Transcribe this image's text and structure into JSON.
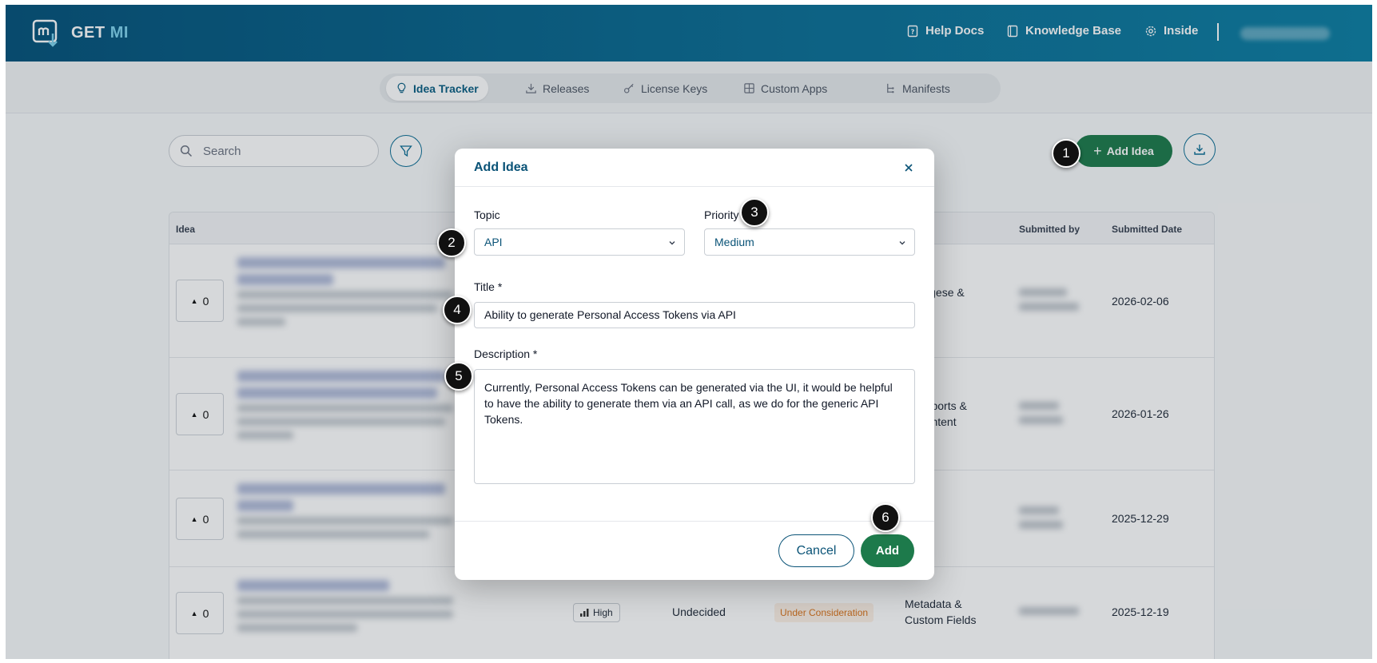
{
  "header": {
    "brand_prefix": "GET",
    "brand_suffix": "MI",
    "nav": [
      {
        "label": "Help Docs",
        "icon": "help-doc-icon"
      },
      {
        "label": "Knowledge Base",
        "icon": "book-icon"
      },
      {
        "label": "Inside",
        "icon": "settings-icon"
      }
    ]
  },
  "tabs": [
    {
      "label": "Idea Tracker",
      "icon": "lightbulb-icon",
      "active": true
    },
    {
      "label": "Releases",
      "icon": "download-icon",
      "active": false
    },
    {
      "label": "License Keys",
      "icon": "key-icon",
      "active": false
    },
    {
      "label": "Custom Apps",
      "icon": "apps-icon",
      "active": false
    },
    {
      "label": "Manifests",
      "icon": "tree-icon",
      "active": false
    }
  ],
  "toolbar": {
    "search_placeholder": "Search",
    "add_idea_label": "Add Idea",
    "add_idea_icon": "+"
  },
  "table": {
    "columns": {
      "idea": "Idea",
      "submitted_by": "Submitted by",
      "submitted_date": "Submitted Date"
    },
    "rows": [
      {
        "votes": "0",
        "category_fragment": "Privilegese &\nissions",
        "date": "2026-02-06"
      },
      {
        "votes": "0",
        "category_fragment": "nal Reports &\nnal Content",
        "date": "2026-01-26"
      },
      {
        "votes": "0",
        "category_fragment": "",
        "date": "2025-12-29"
      },
      {
        "votes": "0",
        "priority": "High",
        "decision": "Undecided",
        "status": "Under Consideration",
        "category": "Metadata &\nCustom Fields",
        "date": "2025-12-19"
      }
    ]
  },
  "modal": {
    "title": "Add Idea",
    "topic_label": "Topic",
    "topic_value": "API",
    "priority_label": "Priority",
    "priority_value": "Medium",
    "title_label": "Title *",
    "title_value": "Ability to generate Personal Access Tokens via API",
    "description_label": "Description *",
    "description_value": "Currently, Personal Access Tokens can be generated via the UI, it would be helpful to have the ability to generate them via an API call, as we do for the generic API Tokens.",
    "cancel_label": "Cancel",
    "add_label": "Add"
  },
  "steps": [
    "1",
    "2",
    "3",
    "4",
    "5",
    "6"
  ],
  "colors": {
    "header": "#04527a",
    "primary_green": "#1d7a4b",
    "accent_blue": "#0a5377",
    "status_orange": "#d9731c"
  }
}
